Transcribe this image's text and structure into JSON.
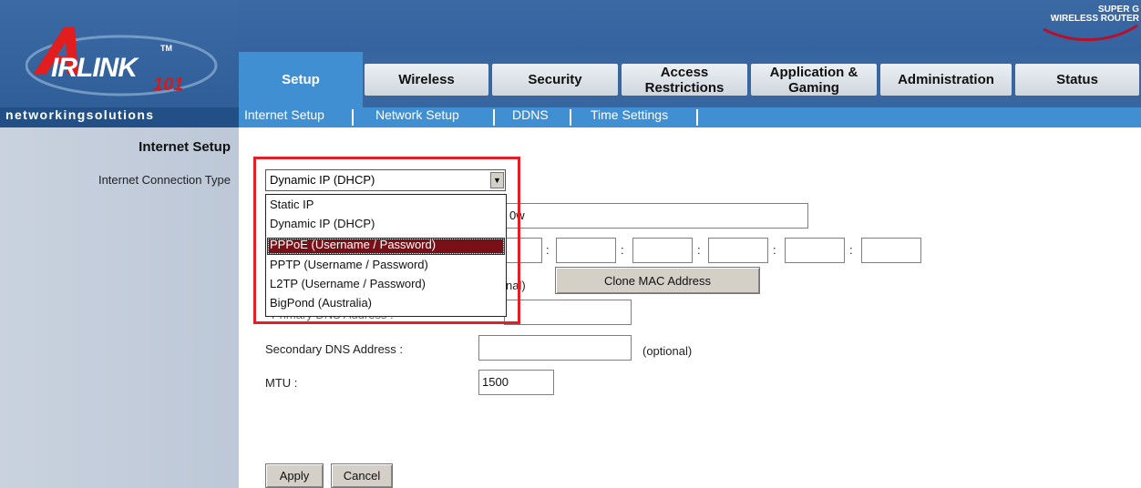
{
  "brand": {
    "logo_word": "IRLINK",
    "logo_number": "101",
    "logo_tm": "TM",
    "badge_line1": "SUPER G",
    "badge_line2": "WIRELESS ROUTER",
    "tagline": "networkingsolutions"
  },
  "tabs": [
    {
      "label": "Setup",
      "active": true
    },
    {
      "label": "Wireless",
      "active": false
    },
    {
      "label": "Security",
      "active": false
    },
    {
      "label": "Access\nRestrictions",
      "active": false
    },
    {
      "label": "Application &\nGaming",
      "active": false
    },
    {
      "label": "Administration",
      "active": false
    },
    {
      "label": "Status",
      "active": false
    }
  ],
  "subnav": [
    "Internet Setup",
    "Network Setup",
    "DDNS",
    "Time Settings"
  ],
  "left": {
    "section_title": "Internet Setup",
    "connection_label": "Internet Connection Type"
  },
  "form": {
    "connection_type_value": "Dynamic IP (DHCP)",
    "hostname_partial": "0w",
    "mac_partial_label": "nal)",
    "clone_mac_button": "Clone MAC Address",
    "primary_dns_partial": "Primary DNS Address :",
    "secondary_dns_label": "Secondary DNS Address :",
    "secondary_dns_value": "",
    "secondary_dns_hint": "(optional)",
    "mtu_label": "MTU :",
    "mtu_value": "1500",
    "apply_button": "Apply",
    "cancel_button": "Cancel"
  },
  "dropdown_options": [
    "Static IP",
    "Dynamic IP (DHCP)",
    "PPPoE (Username / Password)",
    "PPTP (Username / Password)",
    "L2TP (Username / Password)",
    "BigPond (Australia)"
  ],
  "dropdown_selected_index": 2,
  "colors": {
    "header_blue": "#3766a0",
    "active_tab": "#3f8fd2",
    "highlight_red": "#e01f26",
    "selected_option": "#7a1017"
  }
}
